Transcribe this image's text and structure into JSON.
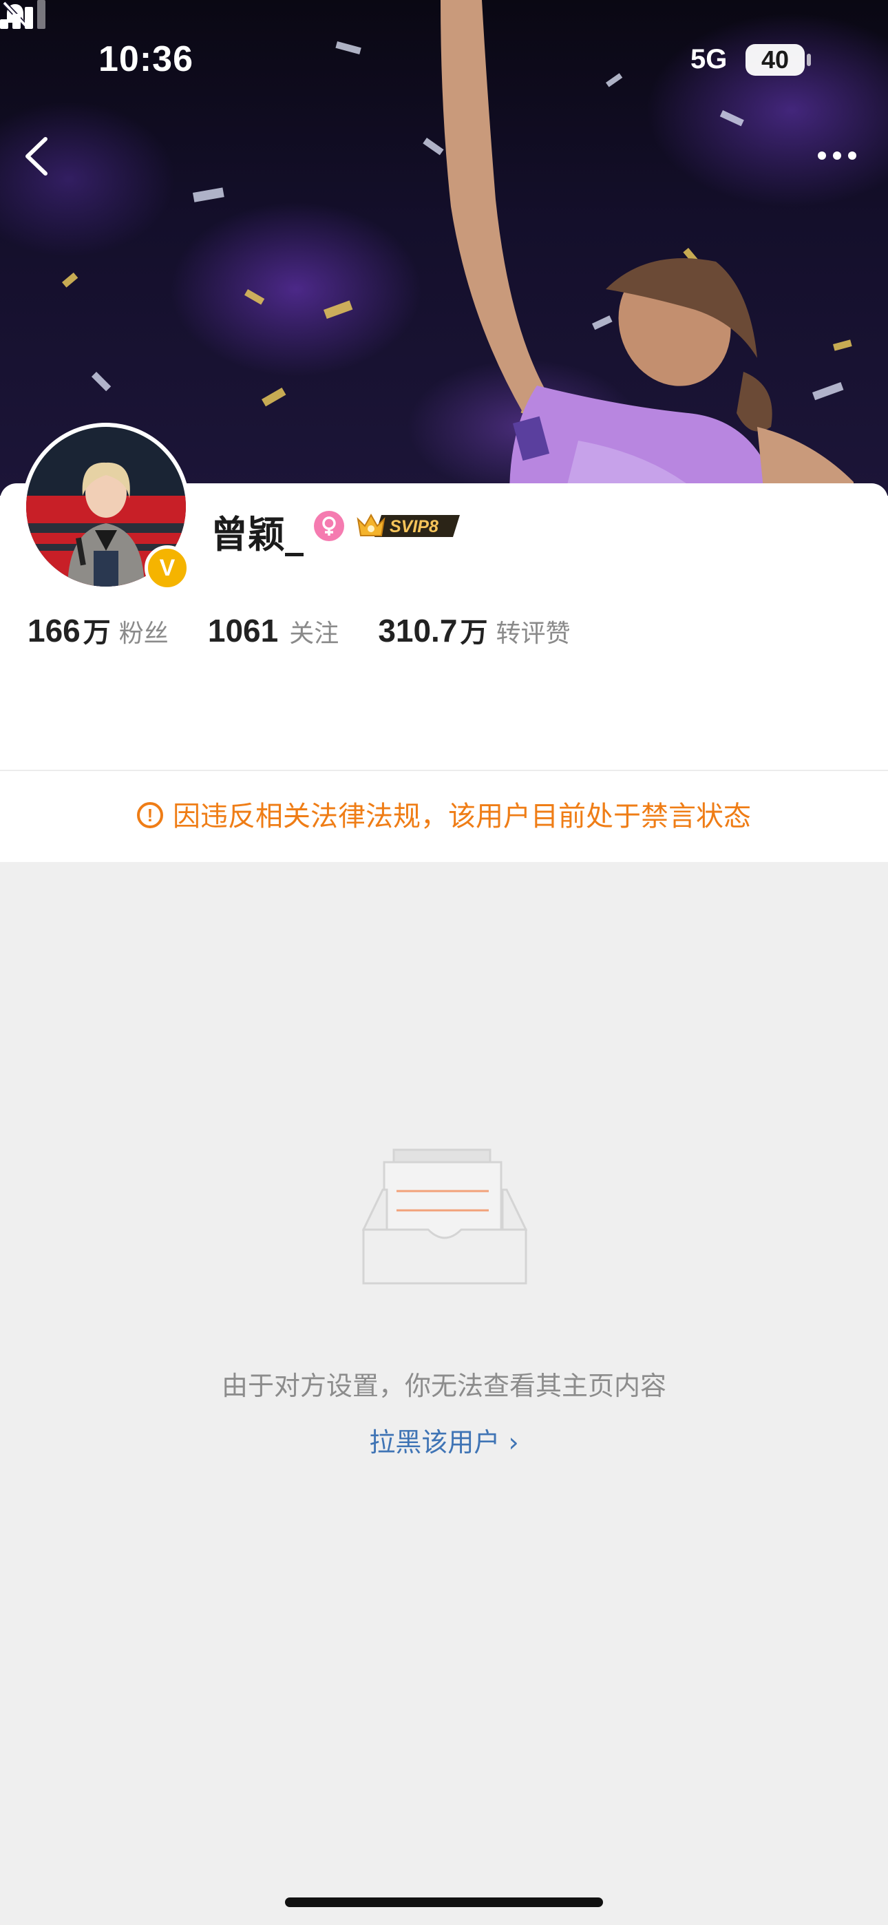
{
  "status_bar": {
    "time": "10:36",
    "network": "5G",
    "battery_level": "40"
  },
  "profile": {
    "username": "曾颖_",
    "vip_badge": "SVIP8",
    "verified_mark": "V",
    "stats": [
      {
        "value": "166",
        "unit": "万",
        "label": "粉丝"
      },
      {
        "value": "1061",
        "unit": "",
        "label": "关注"
      },
      {
        "value": "310.7",
        "unit": "万",
        "label": "转评赞"
      }
    ]
  },
  "notice": {
    "icon": "!",
    "text": "因违反相关法律法规，该用户目前处于禁言状态",
    "color": "#ef7d16"
  },
  "empty_state": {
    "message": "由于对方设置，你无法查看其主页内容",
    "block_link": "拉黑该用户 ›",
    "link_color": "#3f74b5"
  },
  "icons": {
    "back": "chevron-left-icon",
    "more": "more-horizontal-icon",
    "mute": "bell-slash-icon",
    "signal": "cellular-signal-icon",
    "gender": "female-icon",
    "empty": "empty-inbox-icon"
  }
}
